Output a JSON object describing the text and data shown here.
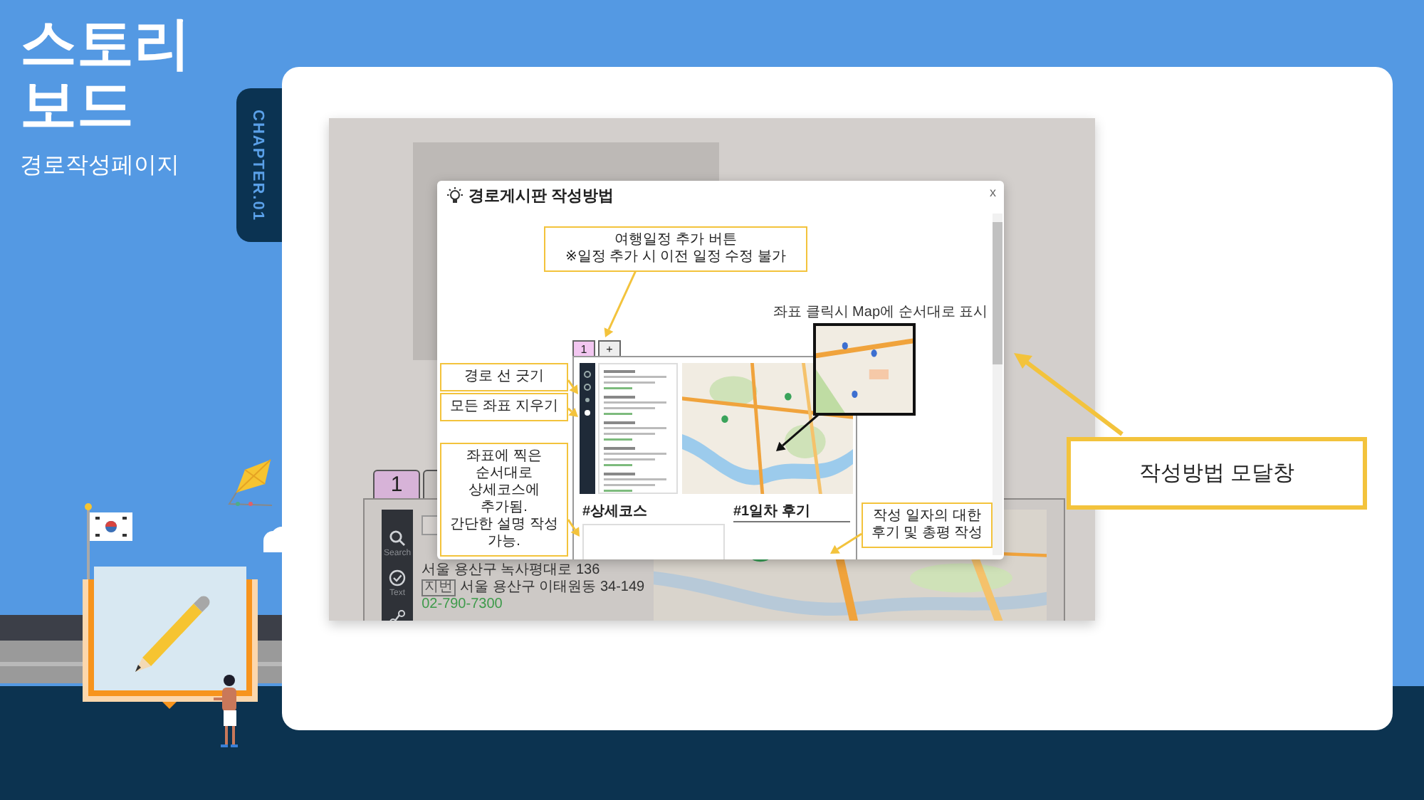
{
  "slide": {
    "title_lines": [
      "스토리",
      "보드"
    ],
    "subtitle": "경로작성페이지",
    "chapter": "CHAPTER.01"
  },
  "background_app": {
    "tabs": [
      {
        "label": "1",
        "selected": true
      },
      {
        "selected": false
      }
    ],
    "sidebar": [
      {
        "label": "Search"
      },
      {
        "label": "Text"
      }
    ],
    "place": {
      "address": "서울 용산구 녹사평대로 136",
      "lot_tag": "지번",
      "lot_address": "서울 용산구 이태원동 34-149",
      "phone": "02-790-7300"
    }
  },
  "modal": {
    "title": "경로게시판 작성방법",
    "close": "x",
    "example": {
      "tabs": [
        {
          "label": "1",
          "selected": true
        },
        {
          "label": "+",
          "selected": false
        }
      ],
      "course_heading": "#상세코스",
      "review_heading": "#1일차 후기"
    },
    "map_note": "좌표 클릭시 Map에 순서대로 표시",
    "callouts": [
      {
        "lines": [
          "여행일정 추가 버튼",
          "※일정 추가 시 이전 일정 수정 불가"
        ]
      },
      {
        "lines": [
          "경로 선 긋기"
        ]
      },
      {
        "lines": [
          "모든 좌표 지우기"
        ]
      },
      {
        "lines": [
          "좌표에 찍은 순서대로",
          "상세코스에 추가됨.",
          "간단한 설명 작성 가능."
        ]
      },
      {
        "lines": [
          "작성 일자의 대한",
          "후기 및 총평 작성"
        ]
      }
    ]
  },
  "annotation": {
    "text": "작성방법 모달창"
  }
}
